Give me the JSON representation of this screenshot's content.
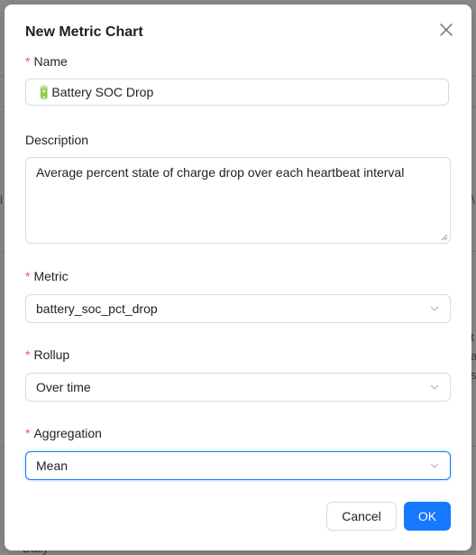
{
  "background": {
    "partial_text_left": "l",
    "partial_text_right_1": "\\",
    "partial_text_right_2": "t",
    "partial_text_right_3": "a",
    "partial_text_right_4": "s",
    "partial_text_bottom": "Daily"
  },
  "modal": {
    "title": "New Metric Chart",
    "close_icon": "close-icon"
  },
  "form": {
    "name": {
      "label": "Name",
      "required": true,
      "value": "🔋Battery SOC Drop"
    },
    "description": {
      "label": "Description",
      "required": false,
      "value": "Average percent state of charge drop over each heartbeat interval"
    },
    "metric": {
      "label": "Metric",
      "required": true,
      "value": "battery_soc_pct_drop"
    },
    "rollup": {
      "label": "Rollup",
      "required": true,
      "value": "Over time"
    },
    "aggregation": {
      "label": "Aggregation",
      "required": true,
      "value": "Mean"
    }
  },
  "footer": {
    "cancel_label": "Cancel",
    "ok_label": "OK"
  },
  "colors": {
    "primary": "#1677ff",
    "required_asterisk": "#ff4d4f",
    "border": "#d9d9d9",
    "overlay": "#8a8a8a"
  }
}
